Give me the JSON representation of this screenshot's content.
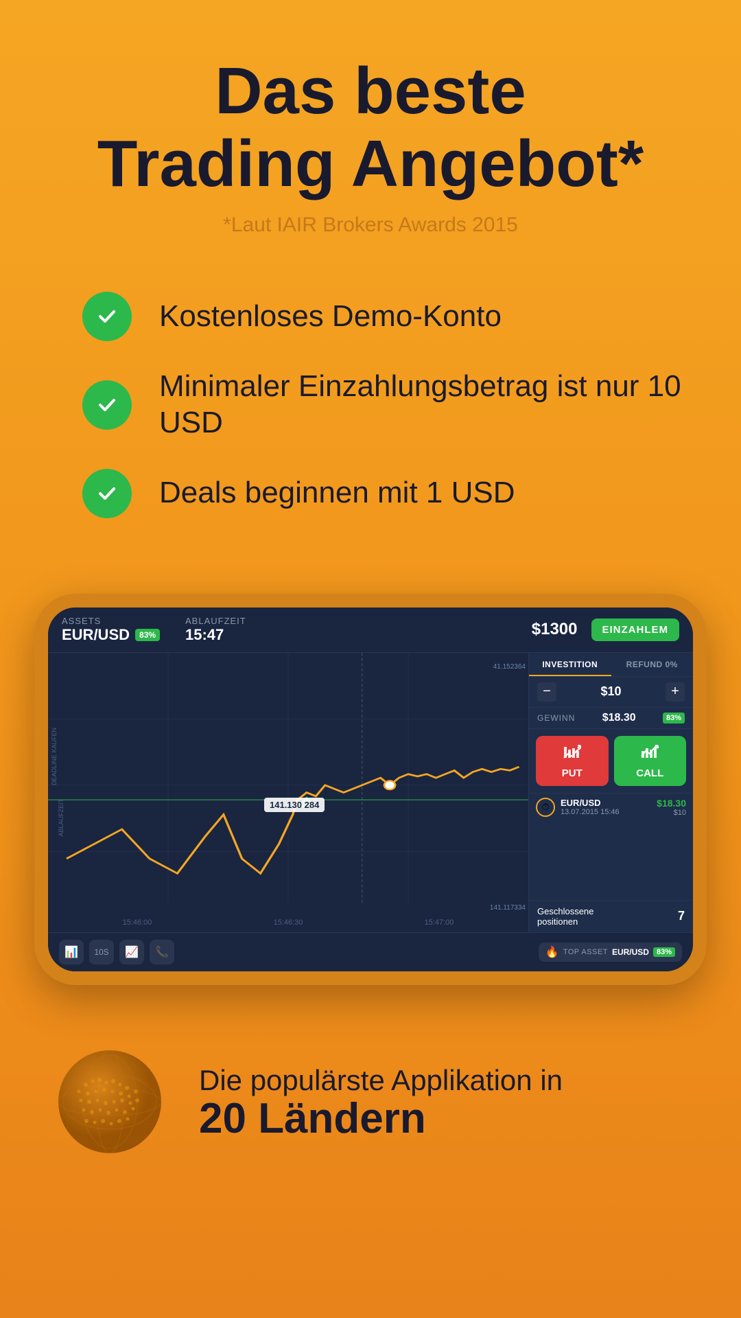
{
  "header": {
    "main_title": "Das beste\nTrading Angebot*",
    "subtitle": "*Laut IAIR Brokers Awards 2015"
  },
  "features": [
    {
      "id": "demo",
      "text": "Kostenloses Demo-Konto"
    },
    {
      "id": "deposit",
      "text": "Minimaler Einzahlungsbetrag ist nur 10 USD"
    },
    {
      "id": "deals",
      "text": "Deals beginnen mit 1 USD"
    }
  ],
  "trading_app": {
    "asset_label": "ASSETS",
    "asset_value": "EUR/USD",
    "asset_percent": "83%",
    "time_label": "ABLAUFZEIT",
    "time_value": "15:47",
    "balance": "$1300",
    "deposit_btn": "EINZAHLEM",
    "tabs": [
      "INVESTITION",
      "REFUND 0%"
    ],
    "amount": "$10",
    "profit_label": "GEWINN",
    "profit_value": "$18.30",
    "profit_percent": "83%",
    "put_label": "PUT",
    "call_label": "CALL",
    "price_tooltip": "141.130 284",
    "chart_price_top": "41.152364",
    "chart_price_bottom": "141.117334",
    "time_ticks": [
      "15:46:00",
      "15:46:30",
      "15:47:00"
    ],
    "vertical_label_deadline": "DEADLINE KAUFEN",
    "vertical_label_ablauf": "ABLAUFZEIT",
    "history_pair": "EUR/USD",
    "history_date": "13.07.2015 15:46",
    "history_profit": "$18.30",
    "history_amount": "$10",
    "closed_label": "Geschlossene\npositionen",
    "closed_count": "7",
    "top_asset_label": "TOP ASSET",
    "top_asset_value": "EUR/USD",
    "top_asset_pct": "83%"
  },
  "bottom": {
    "tagline": "Die populärste Applikation in",
    "highlight": "20 Ländern"
  },
  "colors": {
    "bg_gradient_top": "#f5a623",
    "bg_gradient_bottom": "#e8821a",
    "green": "#2db84b",
    "red": "#e03a3a",
    "dark_blue": "#1a2540",
    "text_dark": "#1a1a2e",
    "orange_accent": "#f5a623"
  }
}
